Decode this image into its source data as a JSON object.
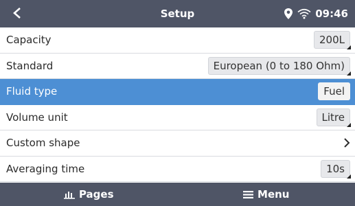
{
  "header": {
    "title": "Setup",
    "back_icon": "back-chevron-icon",
    "status": {
      "location_icon": "location-pin-icon",
      "wifi_icon": "wifi-icon",
      "time": "09:46"
    }
  },
  "settings": [
    {
      "label": "Capacity",
      "value": "200L",
      "control": "value-box",
      "selected": false
    },
    {
      "label": "Standard",
      "value": "European (0 to 180 Ohm)",
      "control": "value-box",
      "selected": false
    },
    {
      "label": "Fluid type",
      "value": "Fuel",
      "control": "value-box",
      "selected": true
    },
    {
      "label": "Volume unit",
      "value": "Litre",
      "control": "value-box",
      "selected": false
    },
    {
      "label": "Custom shape",
      "control": "chevron-right-icon",
      "selected": false
    },
    {
      "label": "Averaging time",
      "value": "10s",
      "control": "value-box",
      "selected": false
    }
  ],
  "footer": {
    "pages_label": "Pages",
    "pages_icon": "pages-icon",
    "menu_label": "Menu",
    "menu_icon": "menu-icon"
  },
  "colors": {
    "header_bg": "#4f5566",
    "selected_row": "#4d8fd4",
    "value_box": "#e7e8eb"
  }
}
